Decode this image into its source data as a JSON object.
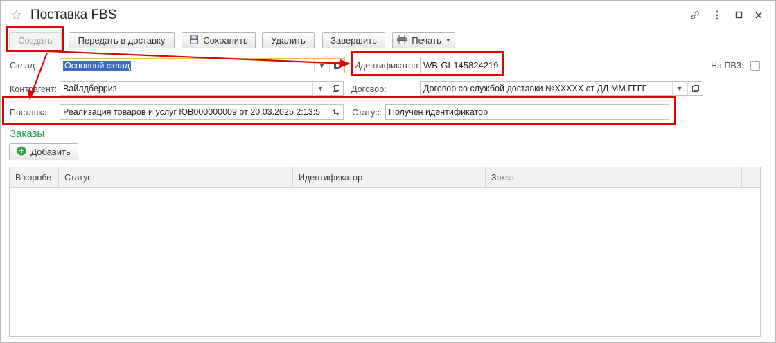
{
  "window": {
    "title": "Поставка FBS",
    "controls": [
      "link-icon",
      "more-icon",
      "minimize-icon",
      "close-icon"
    ]
  },
  "toolbar": {
    "create": "Создать",
    "send_to_delivery": "Передать в доставку",
    "save": "Сохранить",
    "delete": "Удалить",
    "finish": "Завершить",
    "print": "Печать"
  },
  "form": {
    "warehouse_label": "Склад:",
    "warehouse_value": "Основной склад",
    "identifier_label": "Идентификатор:",
    "identifier_value": "WB-GI-145824219",
    "pvz_label": "На ПВЗ:",
    "counterparty_label": "Контрагент:",
    "counterparty_value": "Вайлдберриз",
    "contract_label": "Договор:",
    "contract_value": "Договор со службой доставки №XXXXX от ДД.ММ.ГГГГ",
    "supply_label": "Поставка:",
    "supply_value": "Реализация товаров и услуг ЮВ000000009 от 20.03.2025 2:13:5",
    "status_label": "Статус:",
    "status_value": "Получен идентификатор"
  },
  "orders": {
    "title": "Заказы",
    "add_button": "Добавить",
    "columns": [
      "В коробе",
      "Статус",
      "Идентификатор",
      "Заказ"
    ],
    "rows": []
  },
  "colors": {
    "annotation": "#e00000",
    "section_title": "#1e9b4a",
    "selection": "#3c6ec9",
    "focus_border": "#e5c04b"
  }
}
